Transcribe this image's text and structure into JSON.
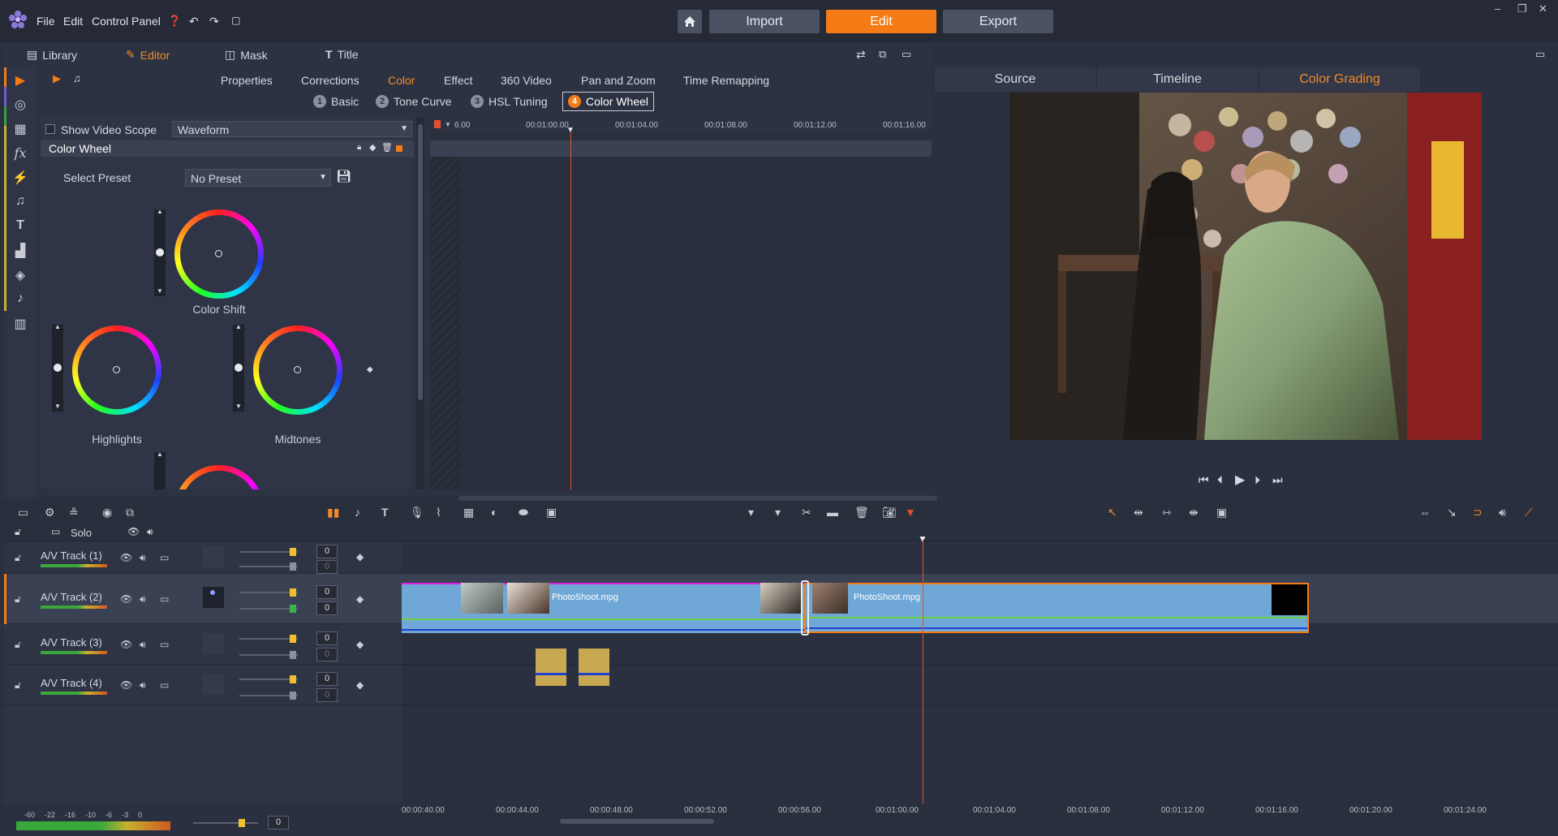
{
  "topbar": {
    "menu": [
      "File",
      "Edit",
      "Control Panel"
    ],
    "modes": {
      "import": "Import",
      "edit": "Edit",
      "export": "Export"
    },
    "window_controls": [
      "–",
      "❐",
      "✕"
    ]
  },
  "editor_nav": {
    "tabs": [
      "Library",
      "Editor",
      "Mask",
      "Title"
    ],
    "active_tab": "Editor"
  },
  "sub_tabs": [
    "Properties",
    "Corrections",
    "Color",
    "Effect",
    "360 Video",
    "Pan and Zoom",
    "Time Remapping"
  ],
  "active_sub_tab": "Color",
  "steps": [
    {
      "num": "1",
      "label": "Basic"
    },
    {
      "num": "2",
      "label": "Tone Curve"
    },
    {
      "num": "3",
      "label": "HSL Tuning"
    },
    {
      "num": "4",
      "label": "Color Wheel"
    }
  ],
  "scope": {
    "checkbox_label": "Show Video Scope",
    "dropdown_value": "Waveform"
  },
  "panel": {
    "title": "Color Wheel",
    "preset_label": "Select Preset",
    "preset_value": "No Preset"
  },
  "wheels": [
    "Color Shift",
    "Highlights",
    "Midtones"
  ],
  "kf_ruler": [
    "6.00",
    "00:01:00.00",
    "00:01:04.00",
    "00:01:08.00",
    "00:01:12.00",
    "00:01:16.00"
  ],
  "player": {
    "tabs": [
      "Source",
      "Timeline",
      "Color Grading"
    ],
    "active_tab": "Color Grading"
  },
  "timeline": {
    "solo_label": "Solo",
    "tracks": [
      {
        "name": "A/V Track (1)",
        "v1": "0",
        "v2": "0"
      },
      {
        "name": "A/V Track (2)",
        "v1": "0",
        "v2": "0"
      },
      {
        "name": "A/V Track (3)",
        "v1": "0",
        "v2": "0"
      },
      {
        "name": "A/V Track (4)",
        "v1": "0",
        "v2": "0"
      }
    ],
    "clips": [
      "PhotoShoot.mpg",
      "PhotoShoot.mpg"
    ],
    "ruler": [
      "00:00:40.00",
      "00:00:44.00",
      "00:00:48.00",
      "00:00:52.00",
      "00:00:56.00",
      "00:01:00.00",
      "00:01:04.00",
      "00:01:08.00",
      "00:01:12.00",
      "00:01:16.00",
      "00:01:20.00",
      "00:01:24.00"
    ],
    "vu_scale": [
      "-60",
      "-22",
      "-16",
      "-10",
      "-6",
      "-3",
      "0"
    ],
    "master_value": "0"
  },
  "colors": {
    "accent": "#f47b16",
    "clip": "#6fa8d6",
    "playhead": "#e05030"
  }
}
